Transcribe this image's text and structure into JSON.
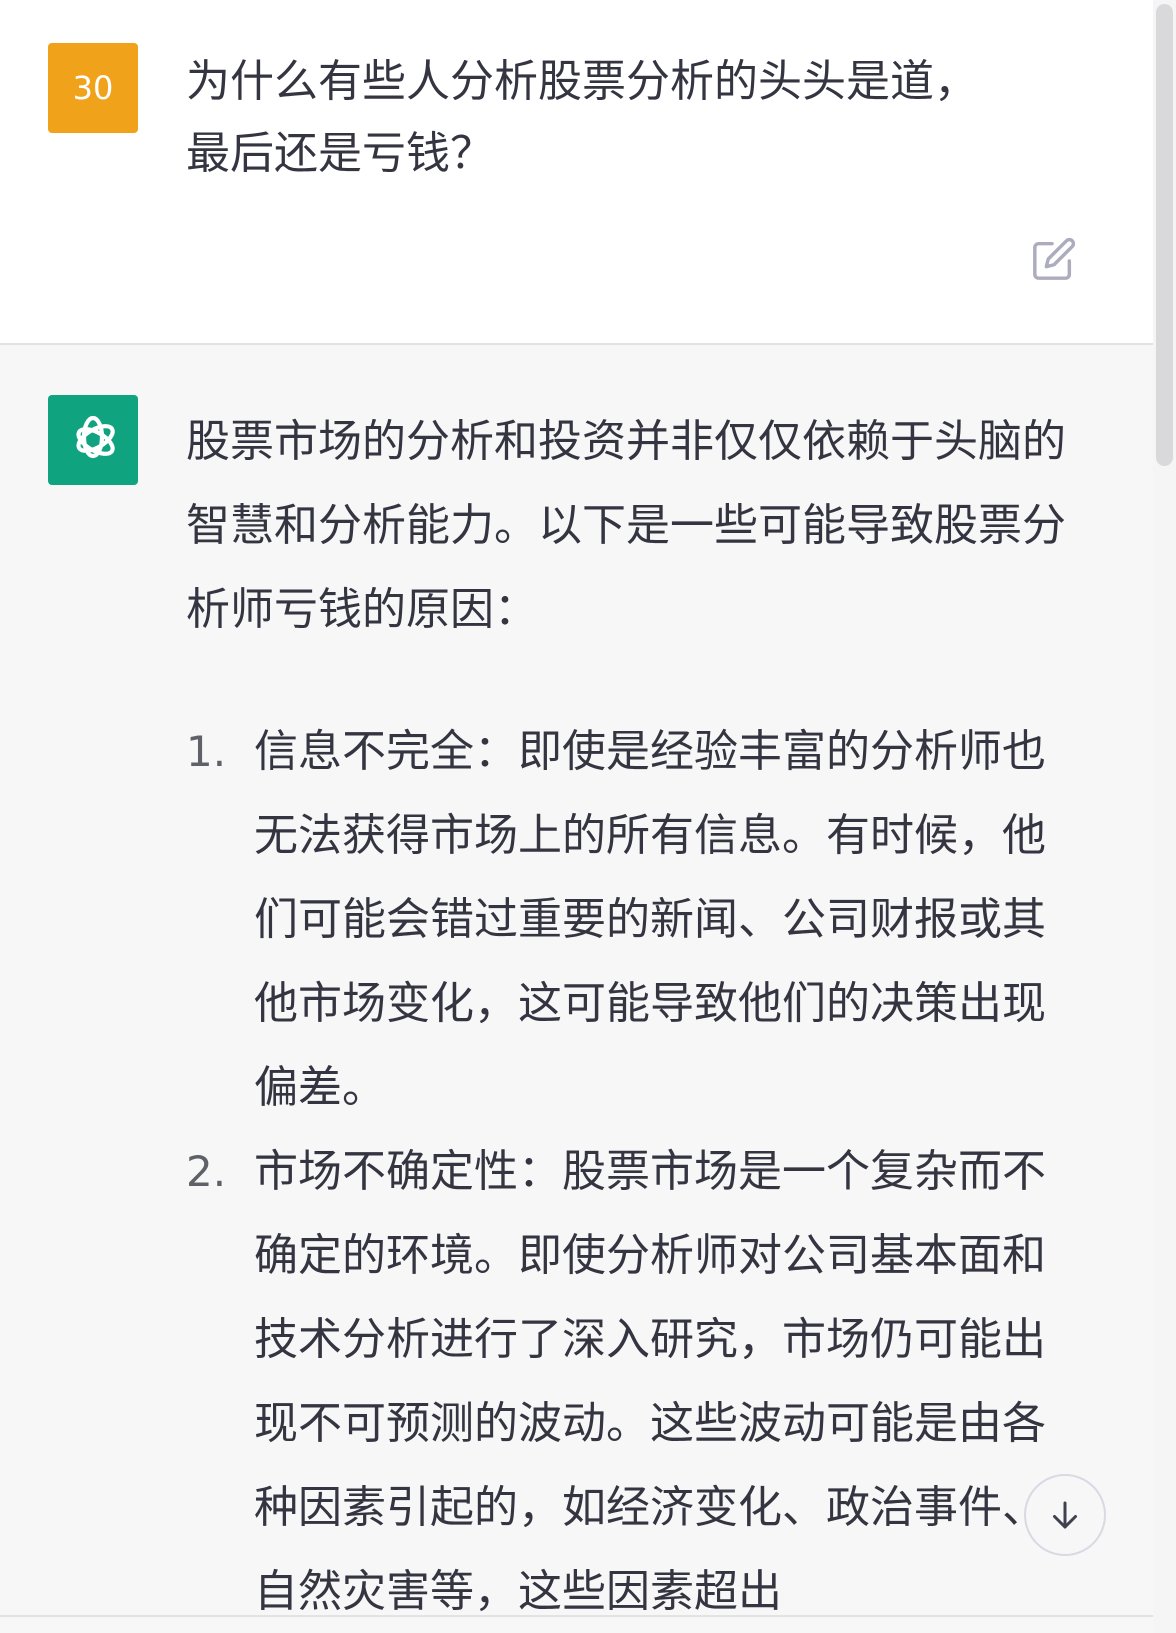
{
  "user": {
    "avatar_label": "30",
    "question_line1": "为什么有些人分析股票分析的头头是道，",
    "question_line2": "最后还是亏钱？"
  },
  "assistant": {
    "intro": "股票市场的分析和投资并非仅仅依赖于头脑的智慧和分析能力。以下是一些可能导致股票分析师亏钱的原因：",
    "items": [
      {
        "number": "1.",
        "text": "信息不完全：即使是经验丰富的分析师也无法获得市场上的所有信息。有时候，他们可能会错过重要的新闻、公司财报或其他市场变化，这可能导致他们的决策出现偏差。"
      },
      {
        "number": "2.",
        "text": "市场不确定性：股票市场是一个复杂而不确定的环境。即使分析师对公司基本面和技术分析进行了深入研究，市场仍可能出现不可预测的波动。这些波动可能是由各种因素引起的，如经济变化、政治事件、自然灾害等，这些因素超出"
      }
    ]
  },
  "icons": {
    "edit": "edit-icon",
    "openai_logo": "openai-logo-icon",
    "scroll_down": "arrow-down-icon"
  },
  "colors": {
    "user_avatar_bg": "#f0a21b",
    "bot_avatar_bg": "#10a37f",
    "assistant_bg": "#f7f7f8",
    "text": "#343541"
  }
}
